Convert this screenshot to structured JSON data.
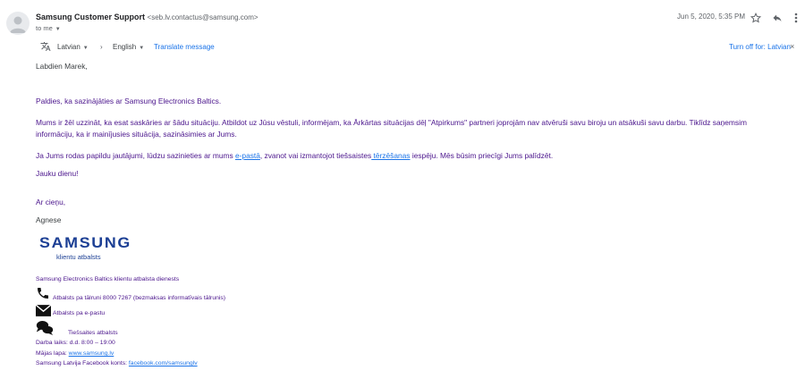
{
  "header": {
    "sender_name": "Samsung Customer Support",
    "sender_email": "<seb.lv.contactus@samsung.com>",
    "recipient": "to me",
    "date": "Jun 5, 2020, 5:35 PM",
    "icons": [
      "person-icon",
      "star-icon",
      "reply-icon",
      "more-vert-icon"
    ]
  },
  "translate_bar": {
    "source_lang": "Latvian",
    "target_lang": "English",
    "translate_label": "Translate message",
    "turn_off_label": "Turn off for: Latvian"
  },
  "body": {
    "greeting": "Labdien Marek,",
    "p1": "Paldies, ka sazinājāties ar Samsung Electronics Baltics.",
    "p2_line1": "Mums ir žēl uzzināt, ka esat saskāries ar šādu situāciju. Atbildot uz Jūsu vēstuli, informējam, ka Ārkārtas situācijas dēļ \"Atpirkums\" partneri joprojām nav atvēruši savu biroju un atsākuši savu darbu. Tiklīdz saņemsim",
    "p2_line2": "informāciju, ka ir mainījusies situācija, sazināsimies ar Jums.",
    "p3_pre": "Ja Jums rodas papildu jautājumi, lūdzu sazinieties ar mums ",
    "p3_link1": "e-pastā",
    "p3_mid": ", zvanot vai izmantojot tiešsaistes",
    "p3_link2": " tērzēšanas",
    "p3_post": " iespēju. Mēs būsim  priecīgi Jums palīdzēt.",
    "p4": "Jauku dienu!",
    "closing": "Ar cieņu,",
    "name": "Agnese"
  },
  "signature": {
    "logo_text": "SAMSUNG",
    "logo_sub": "klientu atbalsts",
    "company": "Samsung Electronics Baltics klientu atbalsta dienests",
    "phone_label": "Atbalsts pa tālruni 8000 7267 (bezmaksas informatīvais tālrunis)",
    "email_label": "Atbalsts pa e-pastu",
    "chat_label": "Tiešsaites atbalsts",
    "hours": "Darba laiks: d.d. 8:00 – 19:00",
    "website_prefix": "Mājas lapa: ",
    "website_link": "www.samsung.lv",
    "facebook_prefix": "Samsung Latvija Facebook konts: ",
    "facebook_link": "facebook.com/samsunglv"
  }
}
